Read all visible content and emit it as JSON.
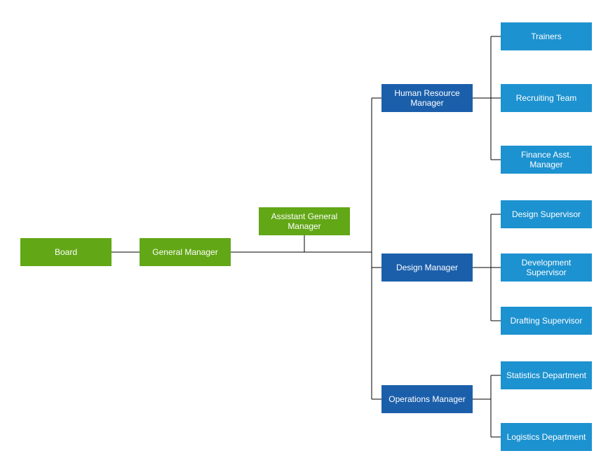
{
  "colors": {
    "green": "#62A716",
    "darkblue": "#1B5FAB",
    "lightblue": "#1D92D0"
  },
  "chart_data": {
    "type": "tree",
    "title": "",
    "nodes": [
      {
        "id": "board",
        "label": "Board",
        "level": 0,
        "color": "green",
        "parent": null
      },
      {
        "id": "gm",
        "label": "General Manager",
        "level": 1,
        "color": "green",
        "parent": "board"
      },
      {
        "id": "agm",
        "label": "Assistant General Manager",
        "level": 2,
        "color": "green",
        "parent": "gm"
      },
      {
        "id": "hrm",
        "label": "Human Resource Manager",
        "level": 3,
        "color": "darkblue",
        "parent": "agm"
      },
      {
        "id": "dm",
        "label": "Design Manager",
        "level": 3,
        "color": "darkblue",
        "parent": "agm"
      },
      {
        "id": "om",
        "label": "Operations Manager",
        "level": 3,
        "color": "darkblue",
        "parent": "agm"
      },
      {
        "id": "trainers",
        "label": "Trainers",
        "level": 4,
        "color": "lightblue",
        "parent": "hrm"
      },
      {
        "id": "recruit",
        "label": "Recruiting Team",
        "level": 4,
        "color": "lightblue",
        "parent": "hrm"
      },
      {
        "id": "finasst",
        "label": "Finance Asst. Manager",
        "level": 4,
        "color": "lightblue",
        "parent": "hrm"
      },
      {
        "id": "dsgsup",
        "label": "Design Supervisor",
        "level": 4,
        "color": "lightblue",
        "parent": "dm"
      },
      {
        "id": "devsup",
        "label": "Development Supervisor",
        "level": 4,
        "color": "lightblue",
        "parent": "dm"
      },
      {
        "id": "drfsup",
        "label": "Drafting Supervisor",
        "level": 4,
        "color": "lightblue",
        "parent": "dm"
      },
      {
        "id": "stats",
        "label": "Statistics Department",
        "level": 4,
        "color": "lightblue",
        "parent": "om"
      },
      {
        "id": "logi",
        "label": "Logistics Department",
        "level": 4,
        "color": "lightblue",
        "parent": "om"
      }
    ]
  },
  "nodes": {
    "board": "Board",
    "gm": "General Manager",
    "agm": "Assistant General Manager",
    "hrm": "Human Resource Manager",
    "dm": "Design Manager",
    "om": "Operations Manager",
    "trainers": "Trainers",
    "recruit": "Recruiting Team",
    "finasst": "Finance Asst. Manager",
    "dsgsup": "Design Supervisor",
    "devsup": "Development Supervisor",
    "drfsup": "Drafting Supervisor",
    "stats": "Statistics Department",
    "logi": "Logistics Department"
  }
}
